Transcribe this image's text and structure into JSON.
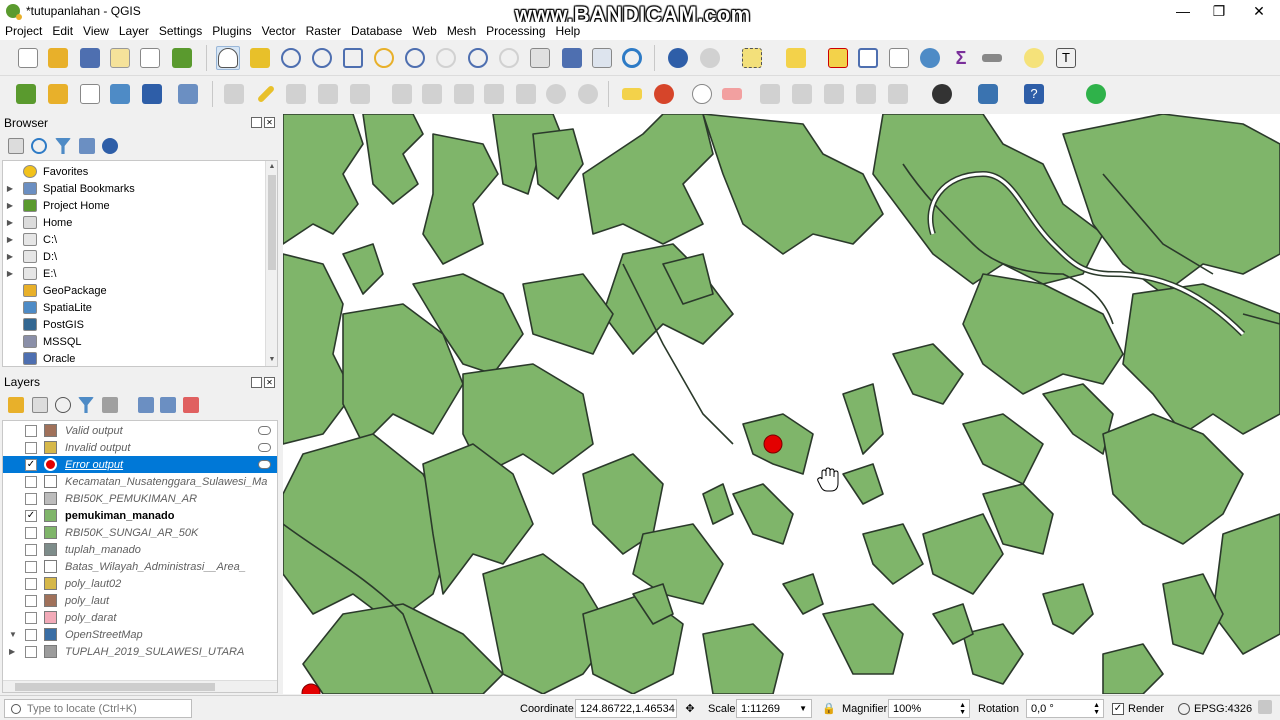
{
  "window": {
    "title": "*tutupanlahan - QGIS",
    "watermark": "www.BANDICAM.com",
    "minimize": "—",
    "maximize": "❐",
    "close": "✕"
  },
  "menu": [
    "Project",
    "Edit",
    "View",
    "Layer",
    "Settings",
    "Plugins",
    "Vector",
    "Raster",
    "Database",
    "Web",
    "Mesh",
    "Processing",
    "Help"
  ],
  "browser": {
    "title": "Browser",
    "items": [
      {
        "label": "Favorites",
        "icon": "star-icon",
        "color": "#f2c21b",
        "expandable": false
      },
      {
        "label": "Spatial Bookmarks",
        "icon": "bookmark-icon",
        "color": "#6b8fc2",
        "expandable": true
      },
      {
        "label": "Project Home",
        "icon": "project-home-icon",
        "color": "#5a9a2e",
        "expandable": true
      },
      {
        "label": "Home",
        "icon": "home-icon",
        "color": "#dcdcdc",
        "expandable": true
      },
      {
        "label": "C:\\",
        "icon": "drive-icon",
        "color": "#e6e6e6",
        "expandable": true
      },
      {
        "label": "D:\\",
        "icon": "drive-icon",
        "color": "#e6e6e6",
        "expandable": true
      },
      {
        "label": "E:\\",
        "icon": "drive-icon",
        "color": "#e6e6e6",
        "expandable": true
      },
      {
        "label": "GeoPackage",
        "icon": "geopackage-icon",
        "color": "#e8b02a",
        "expandable": false
      },
      {
        "label": "SpatiaLite",
        "icon": "spatialite-icon",
        "color": "#4e8bc6",
        "expandable": false
      },
      {
        "label": "PostGIS",
        "icon": "postgis-icon",
        "color": "#336791",
        "expandable": false
      },
      {
        "label": "MSSQL",
        "icon": "mssql-icon",
        "color": "#8a8fa8",
        "expandable": false
      },
      {
        "label": "Oracle",
        "icon": "oracle-icon",
        "color": "#4e6fb0",
        "expandable": false
      }
    ]
  },
  "layers": {
    "title": "Layers",
    "items": [
      {
        "label": "Valid output",
        "checked": false,
        "swatch": "#a0715a",
        "bold": false,
        "selected": false,
        "eye": true
      },
      {
        "label": "Invalid output",
        "checked": false,
        "swatch": "#d6b84a",
        "bold": false,
        "selected": false,
        "eye": true
      },
      {
        "label": "Error output",
        "checked": true,
        "swatch": "#e30000",
        "bold": false,
        "selected": true,
        "eye": true
      },
      {
        "label": "Kecamatan_Nusatenggara_Sulawesi_Ma",
        "checked": false,
        "swatch": "#ffffff",
        "bold": false,
        "selected": false,
        "eye": false
      },
      {
        "label": "RBI50K_PEMUKIMAN_AR",
        "checked": false,
        "swatch": "#bcbcbc",
        "bold": false,
        "selected": false,
        "eye": false
      },
      {
        "label": "pemukiman_manado",
        "checked": true,
        "swatch": "#7fb56a",
        "bold": true,
        "selected": false,
        "eye": false
      },
      {
        "label": "RBI50K_SUNGAI_AR_50K",
        "checked": false,
        "swatch": "#7fb56a",
        "bold": false,
        "selected": false,
        "eye": false
      },
      {
        "label": "tuplah_manado",
        "checked": false,
        "swatch": "#7d8c8a",
        "bold": false,
        "selected": false,
        "eye": false
      },
      {
        "label": "Batas_Wilayah_Administrasi__Area_",
        "checked": false,
        "swatch": "#ffffff",
        "bold": false,
        "selected": false,
        "eye": false
      },
      {
        "label": "poly_laut02",
        "checked": false,
        "swatch": "#d6b84a",
        "bold": false,
        "selected": false,
        "eye": false
      },
      {
        "label": "poly_laut",
        "checked": false,
        "swatch": "#a0715a",
        "bold": false,
        "selected": false,
        "eye": false
      },
      {
        "label": "poly_darat",
        "checked": false,
        "swatch": "#f2aab8",
        "bold": false,
        "selected": false,
        "eye": false
      },
      {
        "label": "OpenStreetMap",
        "checked": false,
        "swatch": "#3a6ea5",
        "bold": false,
        "selected": false,
        "eye": false
      },
      {
        "label": "TUPLAH_2019_SULAWESI_UTARA",
        "checked": false,
        "swatch": "#9c9c9c",
        "bold": false,
        "selected": false,
        "eye": false
      }
    ]
  },
  "status": {
    "locate_placeholder": "Type to locate (Ctrl+K)",
    "coordinate_label": "Coordinate",
    "coordinate_value": "124.86722,1.46534",
    "scale_label": "Scale",
    "scale_value": "1:11269",
    "magnifier_label": "Magnifier",
    "magnifier_value": "100%",
    "rotation_label": "Rotation",
    "rotation_value": "0,0 °",
    "render_label": "Render",
    "crs_label": "EPSG:4326"
  },
  "map": {
    "fill_color": "#7fb56a",
    "stroke_color": "#2b3a2b",
    "error_point_color": "#e30000"
  }
}
